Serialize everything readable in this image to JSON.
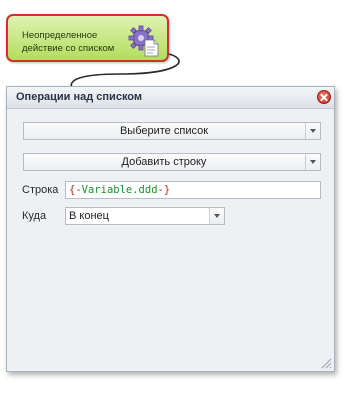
{
  "node": {
    "label": "Неопределенное\nдействие со списком",
    "icon": "gear-document-icon",
    "border_color": "#d2302a"
  },
  "dialog": {
    "title": "Операции над списком",
    "close_icon": "close-icon",
    "list_combo": {
      "value": "Выберите список"
    },
    "operation_combo": {
      "value": "Добавить строку"
    },
    "string_field": {
      "label": "Строка",
      "open": "{-",
      "variable": "Variable.ddd",
      "close": "-}"
    },
    "where_field": {
      "label": "Куда",
      "value": "В конец"
    }
  },
  "colors": {
    "node_fill": "#b3dd5d",
    "token_brace": "#c0281c",
    "token_variable": "#1f8f2a"
  }
}
